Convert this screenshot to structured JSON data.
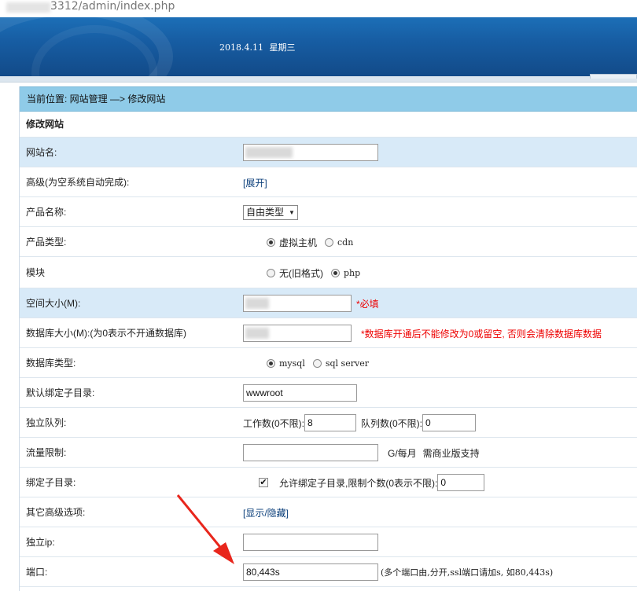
{
  "browser": {
    "url": "3312/admin/index.php"
  },
  "header": {
    "date": "2018.4.11",
    "weekday": "星期三"
  },
  "breadcrumb": "当前位置: 网站管理 —> 修改网站",
  "section_title": "修改网站",
  "form": {
    "site_name": {
      "label": "网站名:",
      "value": ""
    },
    "advanced": {
      "label": "高级(为空系统自动完成):",
      "link": "[展开]"
    },
    "product_name": {
      "label": "产品名称:",
      "value": "自由类型"
    },
    "product_type": {
      "label": "产品类型:",
      "options": [
        "虚拟主机",
        "cdn"
      ],
      "selected": "虚拟主机"
    },
    "module": {
      "label": "模块",
      "options": [
        "无(旧格式)",
        "php"
      ],
      "selected": "php"
    },
    "space_size": {
      "label": "空间大小(M):",
      "value": "",
      "note": "*必填"
    },
    "db_size": {
      "label": "数据库大小(M):(为0表示不开通数据库)",
      "value": "",
      "note": "*数据库开通后不能修改为0或留空, 否则会清除数据库数据"
    },
    "db_type": {
      "label": "数据库类型:",
      "options": [
        "mysql",
        "sql server"
      ],
      "selected": "mysql"
    },
    "default_dir": {
      "label": "默认绑定子目录:",
      "value": "wwwroot"
    },
    "queue": {
      "label": "独立队列:",
      "workers_label": "工作数(0不限):",
      "workers_value": "8",
      "queue_label": "队列数(0不限):",
      "queue_value": "0"
    },
    "traffic": {
      "label": "流量限制:",
      "value": "",
      "unit": "G/每月",
      "note": "需商业版支持"
    },
    "bind_subdir": {
      "label": "绑定子目录:",
      "checked": true,
      "text": "允许绑定子目录,限制个数(0表示不限):",
      "value": "0"
    },
    "other_advanced": {
      "label": "其它高级选项:",
      "link": "[显示/隐藏]"
    },
    "ip": {
      "label": "独立ip:",
      "value": ""
    },
    "port": {
      "label": "端口:",
      "value": "80,443s",
      "note": "(多个端口由,分开,ssl端口请加s, 如80,443s)"
    }
  },
  "colors": {
    "banner": "#175da3",
    "crumb": "#8fcbe8",
    "highlight_row": "#d8eaf8",
    "required": "#e00000",
    "arrow": "#e8261c"
  }
}
